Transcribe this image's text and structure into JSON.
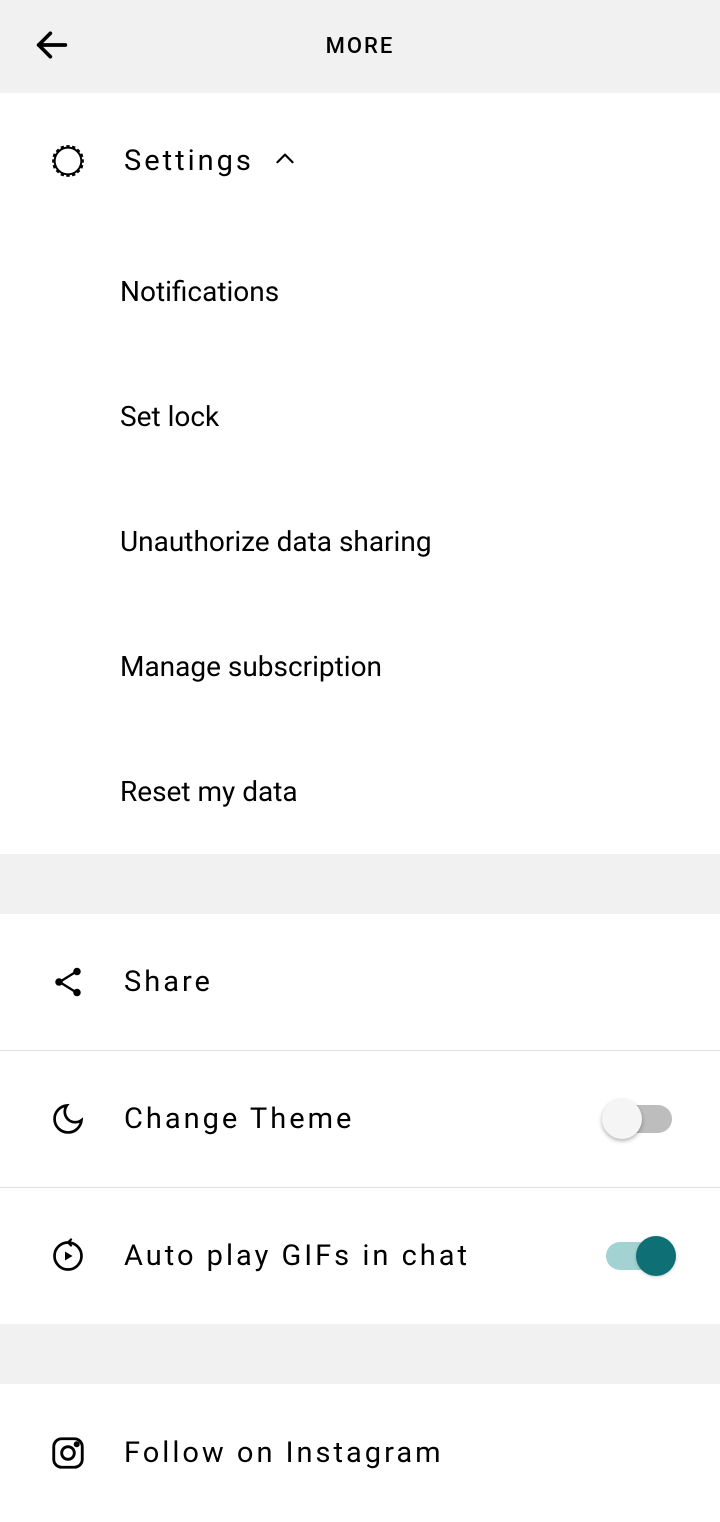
{
  "header": {
    "title": "MORE"
  },
  "settings": {
    "label": "Settings",
    "expanded": true,
    "items": {
      "notifications": "Notifications",
      "set_lock": "Set lock",
      "unauthorize": "Unauthorize data sharing",
      "manage_subscription": "Manage subscription",
      "reset_data": "Reset my data"
    }
  },
  "menu": {
    "share": "Share",
    "change_theme": {
      "label": "Change Theme",
      "enabled": false
    },
    "autoplay_gifs": {
      "label": "Auto play GIFs in chat",
      "enabled": true
    },
    "follow_instagram": "Follow on Instagram"
  }
}
